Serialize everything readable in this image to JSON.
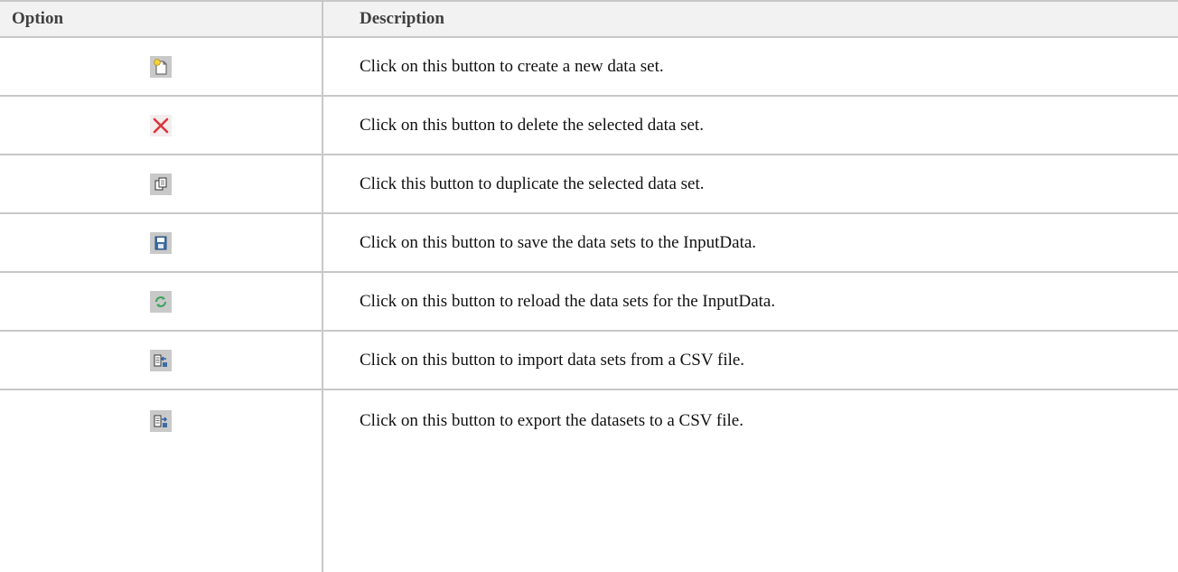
{
  "table": {
    "headers": {
      "option": "Option",
      "description": "Description"
    },
    "rows": [
      {
        "icon": "new-data-set-icon",
        "description": "Click on this button to create a new data set."
      },
      {
        "icon": "delete-icon",
        "description": "Click on this button to delete the selected data set."
      },
      {
        "icon": "duplicate-icon",
        "description": "Click this button to duplicate the selected data set."
      },
      {
        "icon": "save-icon",
        "description": "Click on this button to save the data sets to the InputData."
      },
      {
        "icon": "reload-icon",
        "description": "Click on this button to reload the data sets for the InputData."
      },
      {
        "icon": "import-csv-icon",
        "description": "Click on this button to import data sets from a CSV file."
      },
      {
        "icon": "export-csv-icon",
        "description": "Click on this button to export the datasets to a CSV file."
      }
    ]
  },
  "colors": {
    "border": "#c8c8c8",
    "header_bg": "#f2f2f2",
    "delete_red": "#d9363e",
    "save_blue": "#3b6ea8",
    "reload_green": "#3aa35a"
  }
}
